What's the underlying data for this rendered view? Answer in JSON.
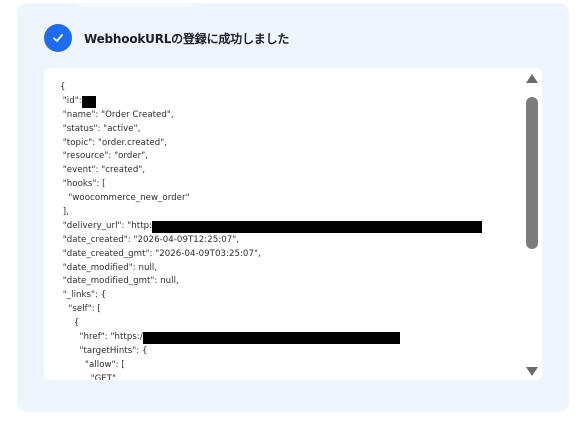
{
  "header": {
    "title": "WebhookURLの登録に成功しました",
    "icon": "check-icon",
    "accent_color": "#1f6cf3"
  },
  "code": {
    "lines": [
      {
        "text": "{"
      },
      {
        "text": " \"id\":",
        "redacted": true
      },
      {
        "text": " \"name\": \"Order Created\","
      },
      {
        "text": " \"status\": \"active\","
      },
      {
        "text": " \"topic\": \"order.created\","
      },
      {
        "text": " \"resource\": \"order\","
      },
      {
        "text": " \"event\": \"created\","
      },
      {
        "text": " \"hooks\": ["
      },
      {
        "text": "   \"woocommerce_new_order\""
      },
      {
        "text": " ],"
      },
      {
        "text": " \"delivery_url\": \"http:",
        "redacted": true
      },
      {
        "text": " \"date_created\": \"2026-04-09T12:25:07\","
      },
      {
        "text": " \"date_created_gmt\": \"2026-04-09T03:25:07\","
      },
      {
        "text": " \"date_modified\": null,"
      },
      {
        "text": " \"date_modified_gmt\": null,"
      },
      {
        "text": " \"_links\": {"
      },
      {
        "text": "   \"self\": ["
      },
      {
        "text": "     {"
      },
      {
        "text": "       \"href\": \"https:/",
        "redacted": true
      },
      {
        "text": "       \"targetHints\": {"
      },
      {
        "text": "         \"allow\": ["
      },
      {
        "text": "           \"GET\","
      }
    ]
  }
}
